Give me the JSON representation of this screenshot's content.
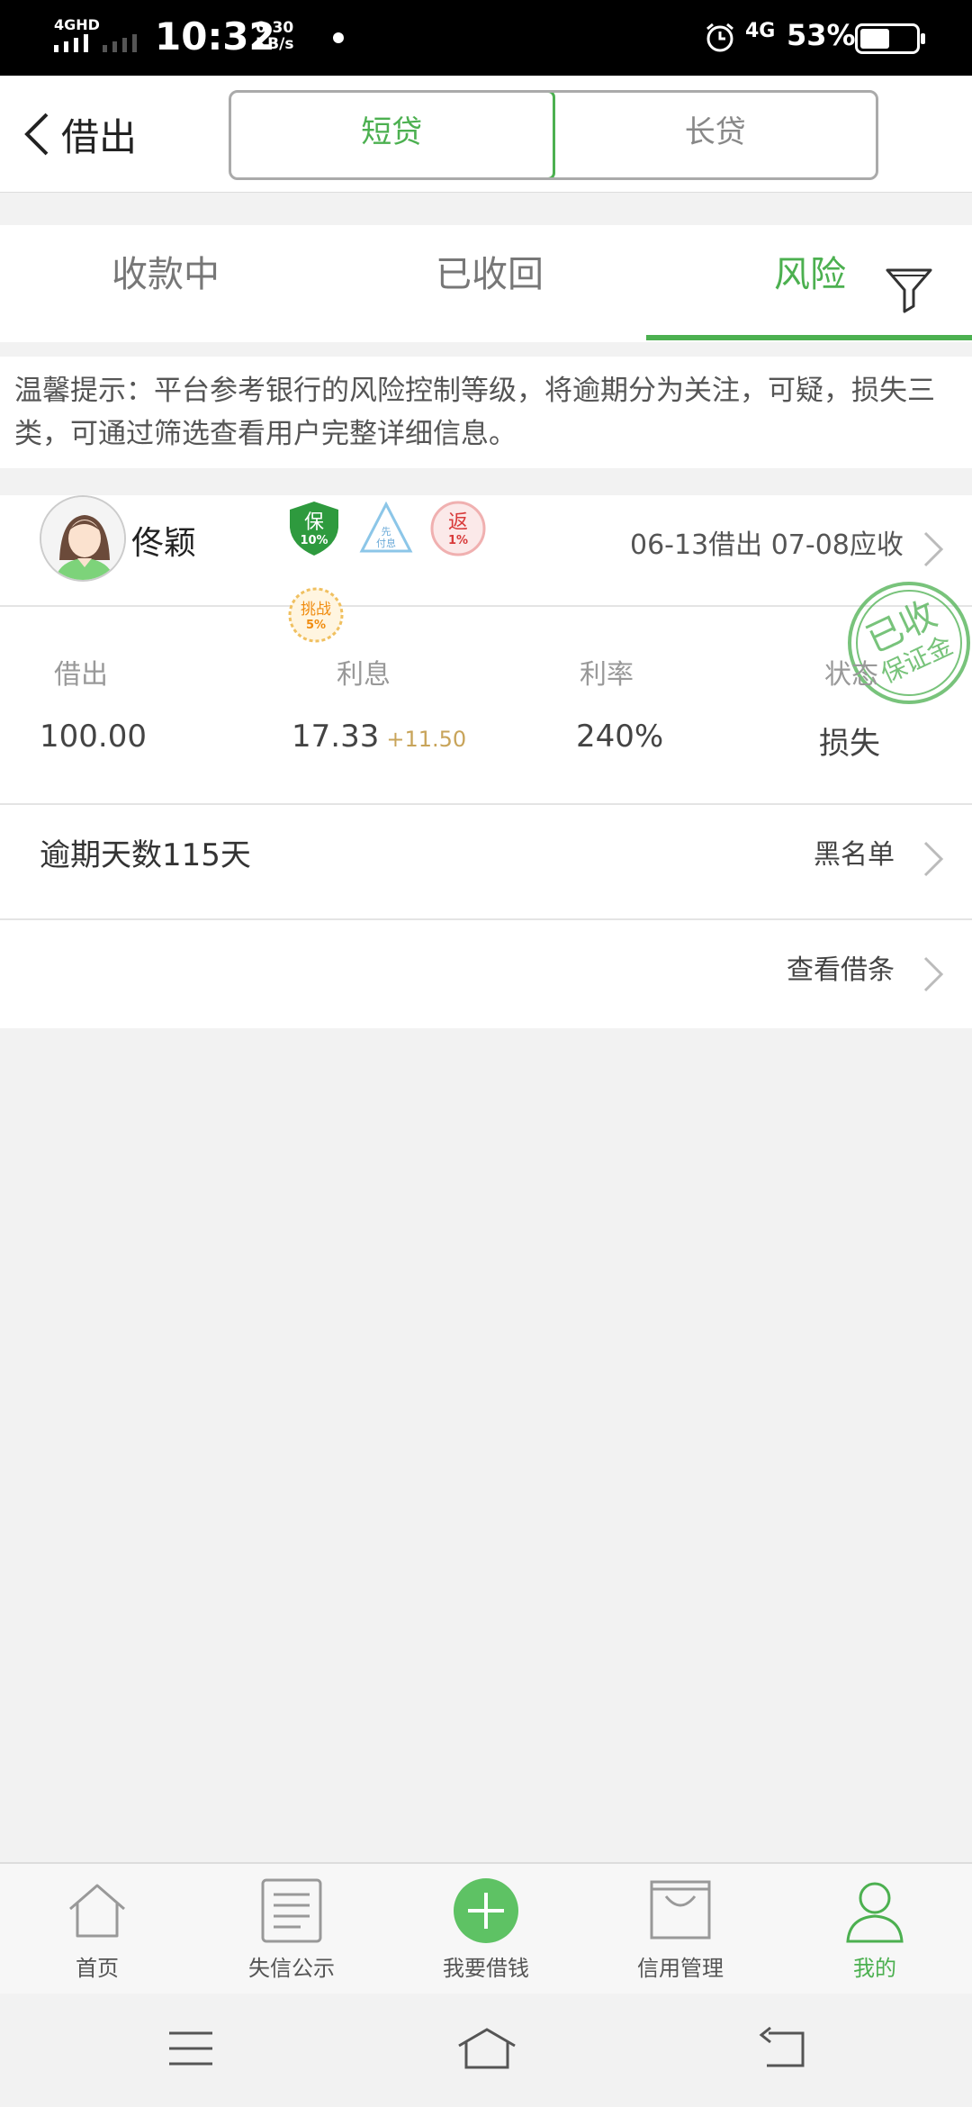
{
  "status_bar": {
    "network": "4GHD",
    "time": "10:32",
    "speed_value": "0.30",
    "speed_unit": "KB/s",
    "network_right": "4G",
    "battery": "53%",
    "battery_level": 0.53
  },
  "header": {
    "back_label": "借出",
    "segments": [
      "短贷",
      "长贷"
    ],
    "active_segment": "短贷"
  },
  "tabs": {
    "items": [
      "收款中",
      "已收回",
      "风险"
    ],
    "active": "风险"
  },
  "notice": "温馨提示：平台参考银行的风险控制等级，将逾期分为关注，可疑，损失三类，可通过筛选查看用户完整详细信息。",
  "loan": {
    "user_name": "佟颖",
    "badges": {
      "guarantee": {
        "label": "保",
        "pct": "10%"
      },
      "interest_first": {
        "label": "先付息"
      },
      "rebate": {
        "label": "返",
        "pct": "1%"
      },
      "challenge": {
        "label": "挑战",
        "pct": "5%"
      }
    },
    "dates": "06-13借出 07-08应收",
    "stamp": {
      "main": "已收",
      "sub": "保证金"
    },
    "labels": {
      "lent": "借出",
      "interest": "利息",
      "rate": "利率",
      "status": "状态"
    },
    "values": {
      "lent": "100.00",
      "interest": "17.33",
      "interest_extra": "+11.50",
      "rate": "240%",
      "status": "损失"
    },
    "overdue": "逾期天数115天",
    "blacklist": "黑名单",
    "view_note": "查看借条"
  },
  "bottom_nav": [
    {
      "label": "首页",
      "icon": "home-icon"
    },
    {
      "label": "失信公示",
      "icon": "list-icon"
    },
    {
      "label": "我要借钱",
      "icon": "plus-circle-icon"
    },
    {
      "label": "信用管理",
      "icon": "credit-card-icon"
    },
    {
      "label": "我的",
      "icon": "user-icon",
      "active": true
    }
  ],
  "colors": {
    "accent": "#4cb050",
    "danger": "#e05050",
    "interest_extra": "#c8a45a"
  }
}
